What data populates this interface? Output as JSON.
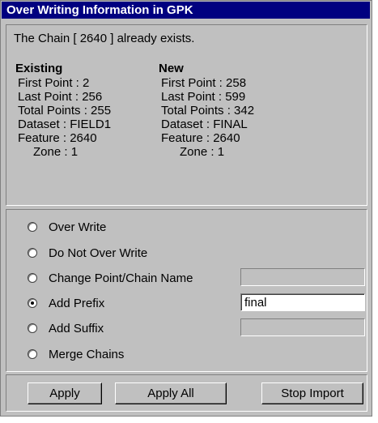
{
  "window": {
    "title": "Over Writing Information in GPK"
  },
  "message": "The Chain [ 2640 ] already exists.",
  "existing": {
    "heading": "Existing",
    "first_point": "First Point : 2",
    "last_point": "Last Point : 256",
    "total_points": "Total Points : 255",
    "dataset": "Dataset : FIELD1",
    "feature": "Feature : 2640",
    "zone": "Zone : 1"
  },
  "new": {
    "heading": "New",
    "first_point": "First Point : 258",
    "last_point": "Last Point : 599",
    "total_points": "Total Points : 342",
    "dataset": "Dataset : FINAL",
    "feature": "Feature : 2640",
    "zone": "Zone : 1"
  },
  "options": {
    "selected": "Add Prefix",
    "items": [
      {
        "label": "Over Write",
        "checked": false
      },
      {
        "label": "Do Not Over Write",
        "checked": false
      },
      {
        "label": "Change Point/Chain Name",
        "checked": false
      },
      {
        "label": "Add Prefix",
        "checked": true
      },
      {
        "label": "Add Suffix",
        "checked": false
      },
      {
        "label": "Merge Chains",
        "checked": false
      }
    ],
    "change_name_value": "",
    "prefix_value": "final",
    "suffix_value": ""
  },
  "buttons": {
    "apply": "Apply",
    "apply_all": "Apply All",
    "stop_import": "Stop Import"
  }
}
